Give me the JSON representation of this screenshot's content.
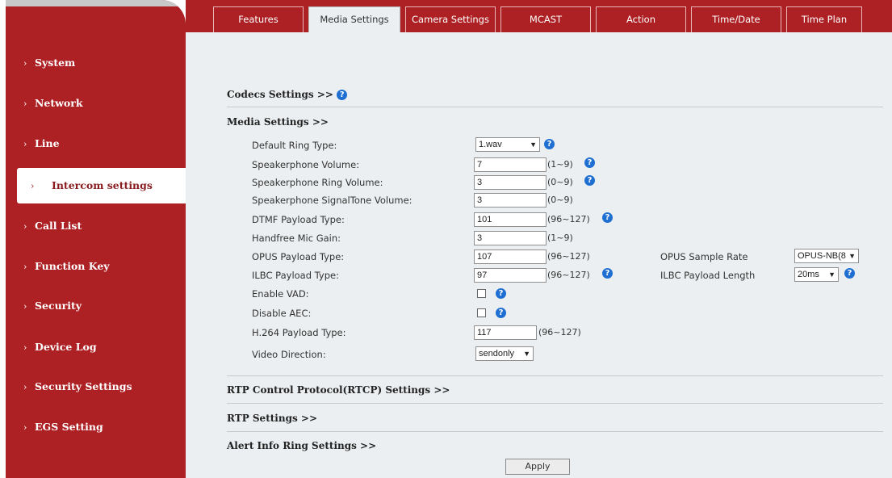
{
  "sidebar": {
    "items": [
      {
        "label": "System"
      },
      {
        "label": "Network"
      },
      {
        "label": "Line"
      },
      {
        "label": "Intercom settings",
        "active": true
      },
      {
        "label": "Call List"
      },
      {
        "label": "Function Key"
      },
      {
        "label": "Security"
      },
      {
        "label": "Device Log"
      },
      {
        "label": "Security Settings"
      },
      {
        "label": "EGS Setting"
      }
    ]
  },
  "tabs": [
    {
      "label": "Features"
    },
    {
      "label": "Media Settings",
      "active": true
    },
    {
      "label": "Camera Settings"
    },
    {
      "label": "MCAST"
    },
    {
      "label": "Action"
    },
    {
      "label": "Time/Date"
    },
    {
      "label": "Time Plan"
    }
  ],
  "sections": {
    "codecs": "Codecs Settings >>",
    "media": "Media Settings >>",
    "rtcp": "RTP Control Protocol(RTCP) Settings >>",
    "rtp": "RTP Settings >>",
    "alert": "Alert Info Ring Settings >>"
  },
  "help_glyph": "?",
  "form": {
    "default_ring_type": {
      "label": "Default Ring Type:",
      "value": "1.wav"
    },
    "speakerphone_volume": {
      "label": "Speakerphone Volume:",
      "value": "7",
      "range": "(1~9)"
    },
    "speakerphone_ring_volume": {
      "label": "Speakerphone Ring Volume:",
      "value": "3",
      "range": "(0~9)"
    },
    "speakerphone_signaltone_volume": {
      "label": "Speakerphone SignalTone Volume:",
      "value": "3",
      "range": "(0~9)"
    },
    "dtmf_payload_type": {
      "label": "DTMF Payload Type:",
      "value": "101",
      "range": "(96~127)"
    },
    "handfree_mic_gain": {
      "label": "Handfree Mic Gain:",
      "value": "3",
      "range": "(1~9)"
    },
    "opus_payload_type": {
      "label": "OPUS Payload Type:",
      "value": "107",
      "range": "(96~127)"
    },
    "opus_sample_rate": {
      "label": "OPUS Sample Rate",
      "value": "OPUS-NB(8"
    },
    "ilbc_payload_type": {
      "label": "ILBC Payload Type:",
      "value": "97",
      "range": "(96~127)"
    },
    "ilbc_payload_length": {
      "label": "ILBC Payload Length",
      "value": "20ms"
    },
    "enable_vad": {
      "label": "Enable VAD:",
      "checked": false
    },
    "disable_aec": {
      "label": "Disable AEC:",
      "checked": false
    },
    "h264_payload_type": {
      "label": "H.264 Payload Type:",
      "value": "117",
      "range": "(96~127)"
    },
    "video_direction": {
      "label": "Video Direction:",
      "value": "sendonly"
    }
  },
  "apply_label": "Apply",
  "colors": {
    "brand": "#ad2024",
    "content_bg": "#eceff1",
    "help_icon": "#1f6fd2"
  }
}
